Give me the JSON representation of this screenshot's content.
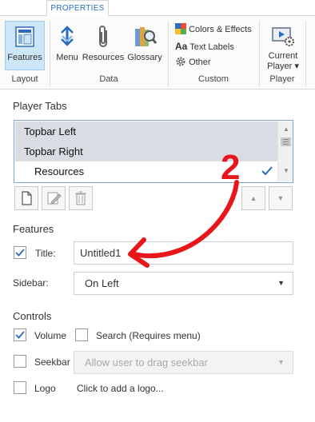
{
  "ribbon": {
    "tab_label": "PROPERTIES",
    "buttons": {
      "features": "Features",
      "menu": "Menu",
      "resources": "Resources",
      "glossary": "Glossary",
      "current_player_line1": "Current",
      "current_player_line2": "Player ▾"
    },
    "custom_items": {
      "colors_effects": "Colors & Effects",
      "text_labels": "Text Labels",
      "other": "Other",
      "text_labels_glyph": "Aa"
    },
    "groups": {
      "layout": "Layout",
      "data": "Data",
      "custom": "Custom",
      "player": "Player"
    }
  },
  "player_tabs": {
    "title": "Player Tabs",
    "items": [
      "Topbar Left",
      "Topbar Right",
      "Resources"
    ]
  },
  "features": {
    "title": "Features",
    "title_label": "Title:",
    "title_value": "Untitled1",
    "sidebar_label": "Sidebar:",
    "sidebar_value": "On Left"
  },
  "controls": {
    "title": "Controls",
    "volume_label": "Volume",
    "search_label": "Search (Requires menu)",
    "seekbar_label": "Seekbar",
    "seekbar_option": "Allow user to drag seekbar",
    "logo_label": "Logo",
    "logo_link": "Click to add a logo..."
  },
  "annotation": {
    "number": "2",
    "color": "#e8161b"
  },
  "colors": {
    "accent": "#2b6cbf",
    "selection": "#cde6f7",
    "list_selected": "#d9dde3"
  }
}
